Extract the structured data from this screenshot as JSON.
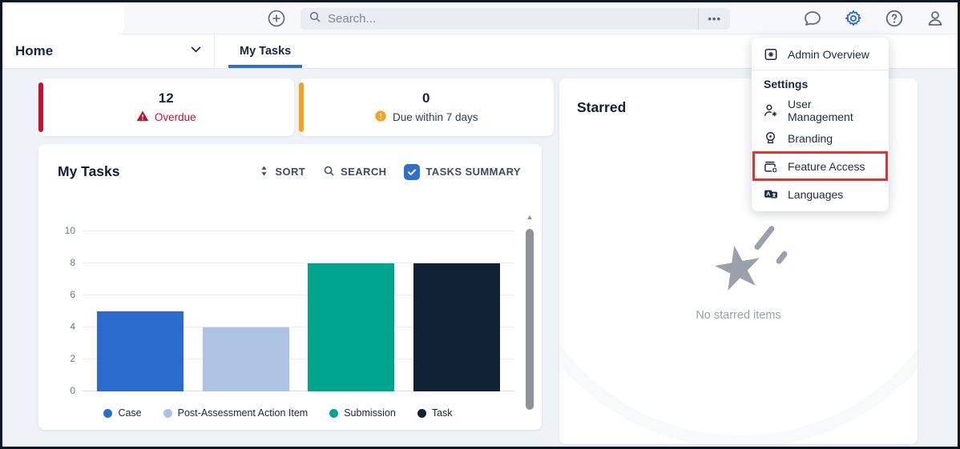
{
  "topbar": {
    "search_placeholder": "Search...",
    "more_label": "•••"
  },
  "nav": {
    "home_label": "Home",
    "active_tab_label": "My Tasks"
  },
  "summary_cards": [
    {
      "count": "12",
      "label": "Overdue",
      "accent_color": "#c3132c",
      "icon": "warning-triangle"
    },
    {
      "count": "0",
      "label": "Due within 7 days",
      "accent_color": "#f6a21e",
      "icon": "warning-circle"
    }
  ],
  "tasks_panel": {
    "title": "My Tasks",
    "sort_label": "SORT",
    "search_label": "SEARCH",
    "tasks_summary_label": "TASKS SUMMARY",
    "tasks_summary_checked": true
  },
  "chart_data": {
    "type": "bar",
    "categories": [
      "Case",
      "Post-Assessment Action Item",
      "Submission",
      "Task"
    ],
    "values": [
      5,
      4,
      8,
      8
    ],
    "colors": [
      "#2a6bcd",
      "#aec2e2",
      "#00a58e",
      "#0e2233"
    ],
    "title": "",
    "xlabel": "",
    "ylabel": "",
    "ylim": [
      0,
      10
    ],
    "yticks": [
      0,
      2,
      4,
      6,
      8,
      10
    ],
    "grid": true,
    "legend_position": "bottom"
  },
  "starred_panel": {
    "title": "Starred",
    "empty_message": "No starred items"
  },
  "settings_menu": {
    "admin_item": {
      "label": "Admin Overview",
      "icon": "admin-folder-gear-icon"
    },
    "section_title": "Settings",
    "items": [
      {
        "label": "User Management",
        "icon": "user-gear-icon",
        "highlighted": false
      },
      {
        "label": "Branding",
        "icon": "badge-icon",
        "highlighted": false
      },
      {
        "label": "Feature Access",
        "icon": "feature-box-plus-icon",
        "highlighted": true
      },
      {
        "label": "Languages",
        "icon": "translate-icon",
        "highlighted": false
      }
    ]
  },
  "colors": {
    "accent_blue": "#2e6fd0",
    "overdue_red": "#c3132c",
    "warning_orange": "#f6a21e",
    "highlight_red": "#e8312a",
    "text_dark": "#16263f",
    "background": "#eff3f8"
  }
}
